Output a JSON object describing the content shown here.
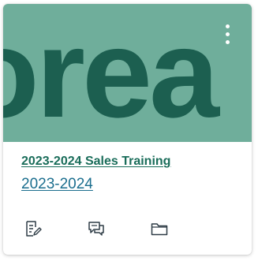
{
  "card": {
    "hero_wordmark": "orea",
    "hero_bg_color": "#6fae9b",
    "hero_text_color": "#1c5f50",
    "menu_icon": "kebab-icon",
    "title": "2023-2024 Sales Training",
    "term": "2023-2024",
    "title_color": "#1a6d5a",
    "term_color": "#1b6e8e",
    "actions": [
      {
        "icon": "assignments-icon"
      },
      {
        "icon": "discussions-icon"
      },
      {
        "icon": "files-icon"
      }
    ]
  }
}
